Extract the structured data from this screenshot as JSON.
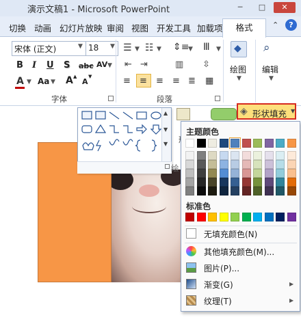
{
  "window": {
    "title": "演示文稿1 - Microsoft PowerPoint",
    "context_tab": "",
    "controls": {
      "minimize": "─",
      "maximize": "□",
      "close": "✕"
    }
  },
  "tabs": [
    {
      "label": "切换"
    },
    {
      "label": "动画"
    },
    {
      "label": "幻灯片放映"
    },
    {
      "label": "审阅"
    },
    {
      "label": "视图"
    },
    {
      "label": "开发工具"
    },
    {
      "label": "加载项"
    }
  ],
  "format_tab": "格式",
  "ribbon": {
    "font_name": "宋体 (正文)",
    "font_size": "18",
    "font_group_label": "字体",
    "paragraph_group_label": "段落",
    "draw_label": "绘图",
    "edit_label": "编辑",
    "bold": "B",
    "italic": "I",
    "underline": "U",
    "shadow": "S",
    "strike": "abc",
    "spacing": "AV",
    "font_color": "A",
    "change_case": "Aa",
    "grow": "A",
    "shrink": "A",
    "accent_color": "#c00000"
  },
  "shape_gallery_label": "绘",
  "shape_style_label": "形",
  "fill_button": {
    "label": "形状填充",
    "icon": "paint-bucket-icon"
  },
  "dropdown": {
    "theme_title": "主题颜色",
    "standard_title": "标准色",
    "theme_top_row": [
      "#ffffff",
      "#000000",
      "#eeece1",
      "#1f497d",
      "#4f81bd",
      "#c0504d",
      "#9bbb59",
      "#8064a2",
      "#4bacc6",
      "#f79646"
    ],
    "theme_shades": [
      [
        "#f2f2f2",
        "#7f7f7f",
        "#ddd9c3",
        "#c6d9f0",
        "#dbe5f1",
        "#f2dcdb",
        "#ebf1dd",
        "#e5e0ec",
        "#dbeef3",
        "#fdeada"
      ],
      [
        "#d8d8d8",
        "#595959",
        "#c4bd97",
        "#8db3e2",
        "#b8cce4",
        "#e5b9b7",
        "#d7e3bc",
        "#ccc1d9",
        "#b7dde8",
        "#fbd5b5"
      ],
      [
        "#bfbfbf",
        "#3f3f3f",
        "#938953",
        "#548dd4",
        "#95b3d7",
        "#d99694",
        "#c3d69b",
        "#b2a2c7",
        "#92cddc",
        "#fac08f"
      ],
      [
        "#a5a5a5",
        "#262626",
        "#494429",
        "#17365d",
        "#366092",
        "#953734",
        "#76923c",
        "#5f497a",
        "#31859b",
        "#e36c09"
      ],
      [
        "#7f7f7f",
        "#0c0c0c",
        "#1d1b10",
        "#0f243e",
        "#244061",
        "#632423",
        "#4f6128",
        "#3f3151",
        "#205867",
        "#974806"
      ]
    ],
    "standard_colors": [
      "#c00000",
      "#ff0000",
      "#ffc000",
      "#ffff00",
      "#92d050",
      "#00b050",
      "#00b0f0",
      "#0070c0",
      "#002060",
      "#7030a0"
    ],
    "selected_color": "#4f81bd",
    "items": [
      {
        "label": "无填充颜色(N)",
        "icon": "no-fill-icon"
      },
      {
        "label": "其他填充颜色(M)...",
        "icon": "color-palette-icon"
      },
      {
        "label": "图片(P)...",
        "icon": "picture-icon"
      },
      {
        "label": "渐变(G)",
        "icon": "gradient-icon",
        "submenu": true
      },
      {
        "label": "纹理(T)",
        "icon": "texture-icon",
        "submenu": true
      }
    ]
  },
  "slide": {
    "shape_fill_color": "#f79646"
  }
}
